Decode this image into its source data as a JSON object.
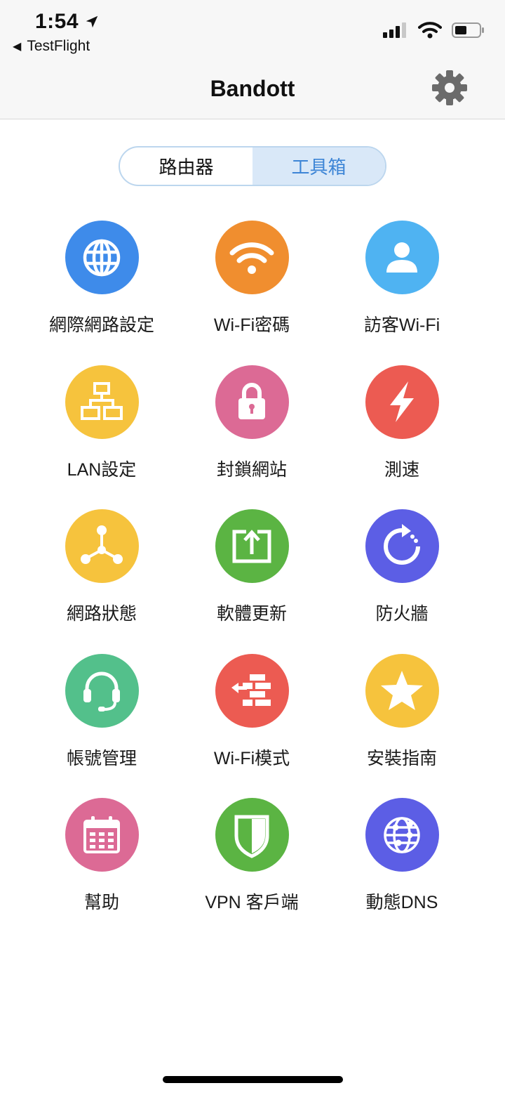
{
  "status_bar": {
    "time": "1:54",
    "back_label": "TestFlight"
  },
  "nav": {
    "title": "Bandott",
    "settings_icon": "gear-icon"
  },
  "segment": {
    "items": [
      {
        "label": "路由器"
      },
      {
        "label": "工具箱"
      }
    ],
    "active_index": 1
  },
  "tools": [
    {
      "label": "網際網路設定",
      "icon": "globe-icon",
      "color": "#3e8bea"
    },
    {
      "label": "Wi-Fi密碼",
      "icon": "wifi-icon",
      "color": "#f08e2f"
    },
    {
      "label": "訪客Wi-Fi",
      "icon": "guest-user-icon",
      "color": "#4fb3f2"
    },
    {
      "label": "LAN設定",
      "icon": "lan-network-icon",
      "color": "#f6c33d"
    },
    {
      "label": "封鎖網站",
      "icon": "lock-icon",
      "color": "#dc6a95"
    },
    {
      "label": "測速",
      "icon": "lightning-icon",
      "color": "#ec5b52"
    },
    {
      "label": "網路狀態",
      "icon": "network-nodes-icon",
      "color": "#f6c33d"
    },
    {
      "label": "軟體更新",
      "icon": "upload-icon",
      "color": "#5bb443"
    },
    {
      "label": "防火牆",
      "icon": "refresh-icon",
      "color": "#5c5ee5"
    },
    {
      "label": "帳號管理",
      "icon": "headset-icon",
      "color": "#53c08b"
    },
    {
      "label": "Wi-Fi模式",
      "icon": "wall-arrow-icon",
      "color": "#ec5b52"
    },
    {
      "label": "安裝指南",
      "icon": "star-icon",
      "color": "#f6c33d"
    },
    {
      "label": "幫助",
      "icon": "calendar-icon",
      "color": "#dc6a95"
    },
    {
      "label": "VPN 客戶端",
      "icon": "shield-icon",
      "color": "#5bb443"
    },
    {
      "label": "動態DNS",
      "icon": "network-globe-icon",
      "color": "#5c5ee5"
    }
  ]
}
